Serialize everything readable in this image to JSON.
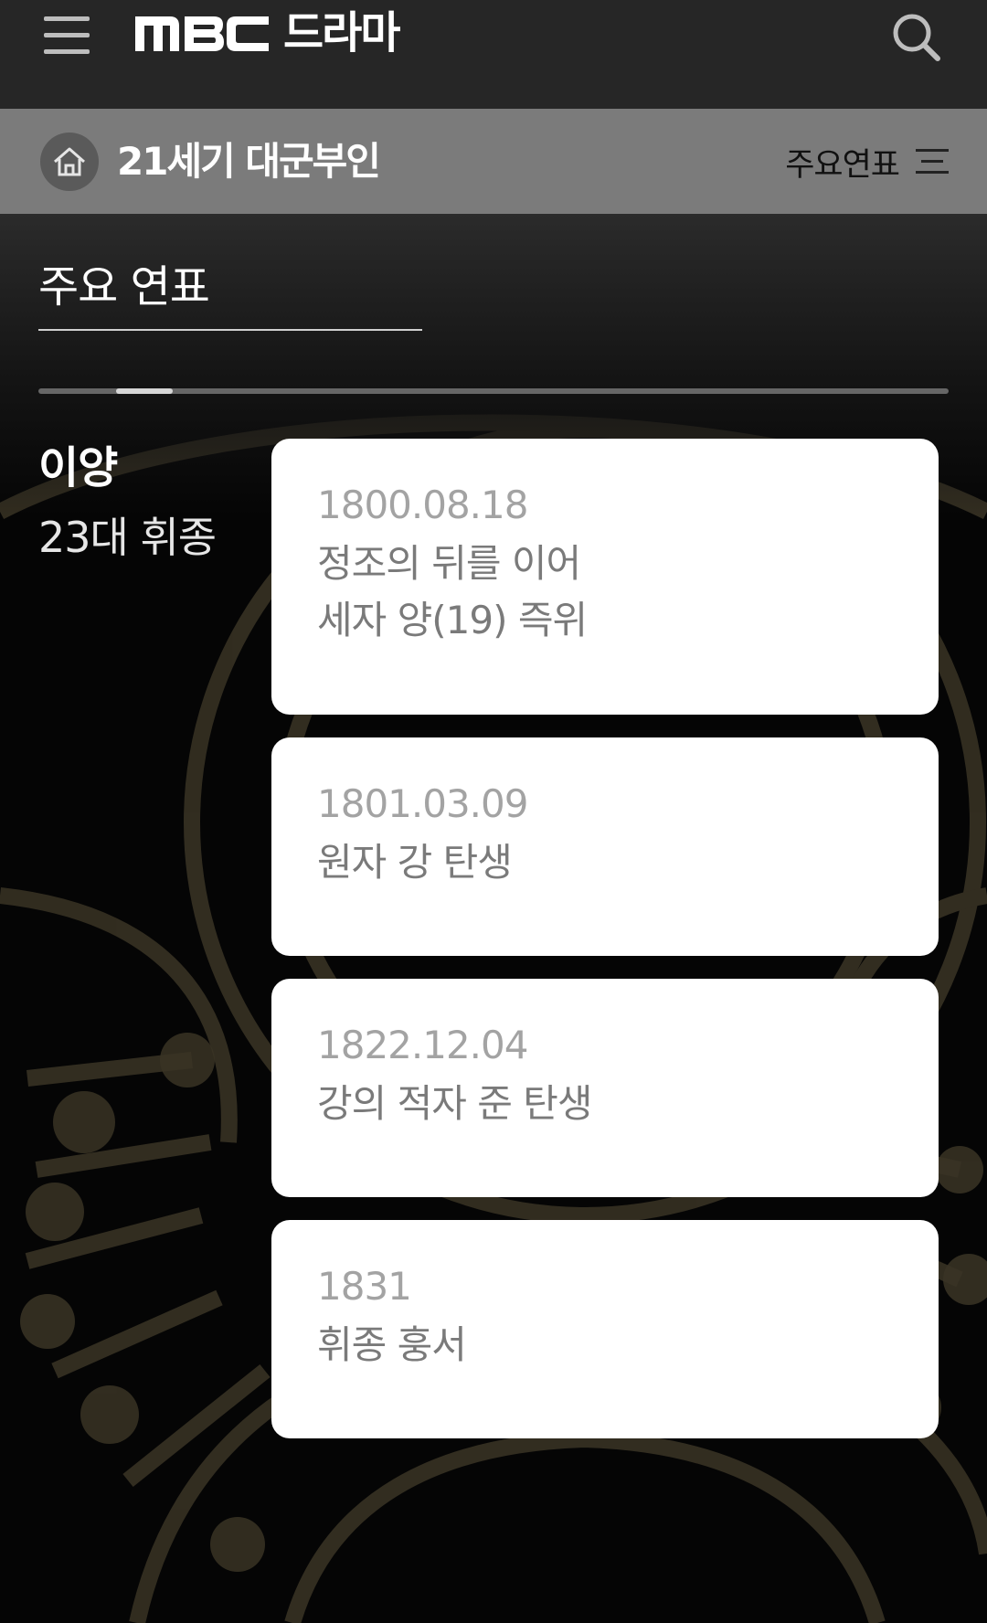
{
  "header": {
    "logo_brand": "MBC",
    "logo_text": "드라마",
    "menu_icon": "hamburger-menu-icon",
    "search_icon": "search-icon"
  },
  "program_bar": {
    "home_icon": "home-icon",
    "title": "21세기 대군부인",
    "section_label": "주요연표",
    "section_icon": "list-menu-icon"
  },
  "main": {
    "heading": "주요 연표",
    "scroll_progress": 0.12,
    "king": {
      "name": "이양",
      "title": "23대 휘종"
    },
    "events": [
      {
        "date": "1800.08.18",
        "description": "정조의 뒤를 이어\n세자 양(19) 즉위"
      },
      {
        "date": "1801.03.09",
        "description": "원자 강 탄생"
      },
      {
        "date": "1822.12.04",
        "description": "강의 적자 준 탄생"
      },
      {
        "date": "1831",
        "description": "휘종 훙서"
      }
    ]
  },
  "colors": {
    "topbar": "#262626",
    "program_bar": "#7b7b7b",
    "background": "#050505",
    "card": "#ffffff",
    "card_date": "#a3a3a3",
    "card_text": "#7a7a7a",
    "ornament": "#3a3425"
  }
}
